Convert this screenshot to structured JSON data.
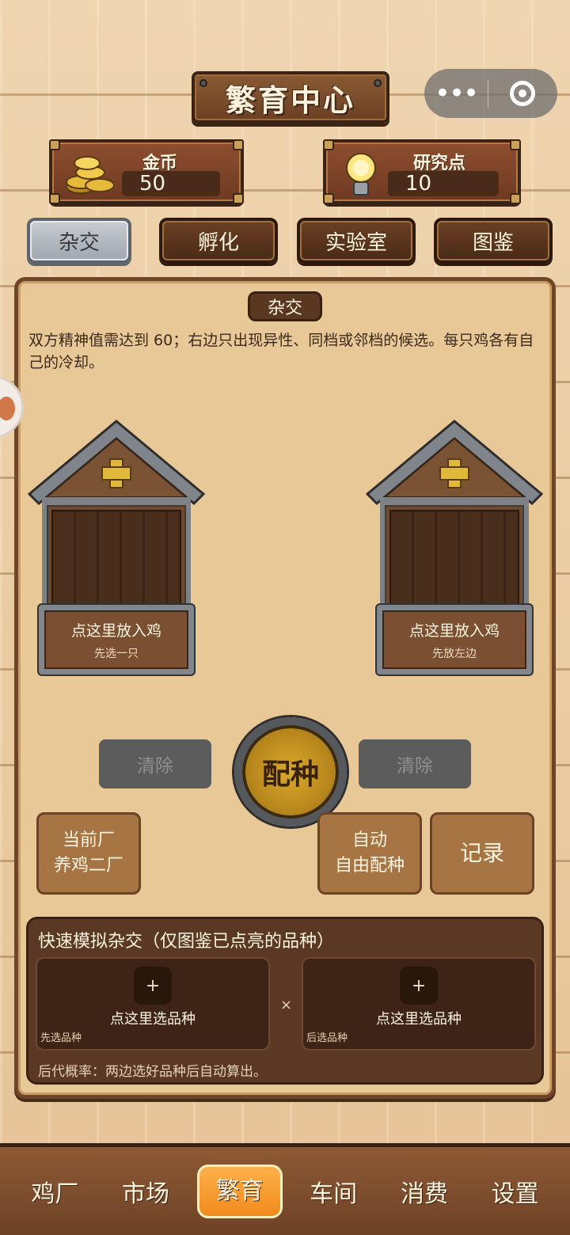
{
  "header": {
    "title": "繁育中心"
  },
  "capsule": {
    "more_icon": "more-dots-icon",
    "close_icon": "target-close-icon"
  },
  "resources": {
    "gold": {
      "label": "金币",
      "value": "50",
      "icon": "coin-stack-icon"
    },
    "research": {
      "label": "研究点",
      "value": "10",
      "icon": "lightbulb-icon"
    }
  },
  "tabs": [
    {
      "label": "杂交",
      "active": true
    },
    {
      "label": "孵化",
      "active": false
    },
    {
      "label": "实验室",
      "active": false
    },
    {
      "label": "图鉴",
      "active": false
    }
  ],
  "cross": {
    "section_title": "杂交",
    "description": "双方精神值需达到 60；右边只出现异性、同档或邻档的候选。每只鸡各有自己的冷却。",
    "left_coop": {
      "label": "点这里放入鸡",
      "sub": "先选一只"
    },
    "right_coop": {
      "label": "点这里放入鸡",
      "sub": "先放左边"
    },
    "clear_left": "清除",
    "clear_right": "清除",
    "breed": "配种",
    "factory": {
      "line1": "当前厂",
      "line2": "养鸡二厂"
    },
    "auto": {
      "line1": "自动",
      "line2": "自由配种"
    },
    "record": "记录"
  },
  "quick_sim": {
    "title": "快速模拟杂交（仅图鉴已点亮的品种）",
    "left": {
      "plus": "+",
      "label": "点这里选品种",
      "sub": "先选品种"
    },
    "times": "×",
    "right": {
      "plus": "+",
      "label": "点这里选品种",
      "sub": "后选品种"
    },
    "note": "后代概率：两边选好品种后自动算出。"
  },
  "nav": [
    {
      "label": "鸡厂",
      "active": false
    },
    {
      "label": "市场",
      "active": false
    },
    {
      "label": "繁育",
      "active": true
    },
    {
      "label": "车间",
      "active": false
    },
    {
      "label": "消费",
      "active": false
    },
    {
      "label": "设置",
      "active": false
    }
  ],
  "colors": {
    "accent_orange": "#f08a1c",
    "wood_dark": "#5a3824",
    "panel_bg": "#e8c896"
  }
}
